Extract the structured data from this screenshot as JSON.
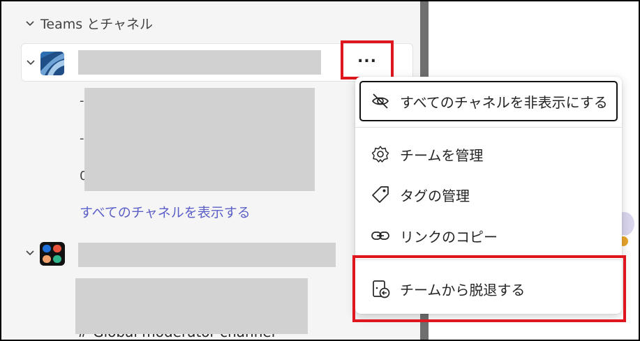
{
  "sidebar": {
    "section_title": "Teams とチャネル",
    "show_all_channels": "すべてのチャネルを表示する",
    "channel_dash_1": "-",
    "channel_dash_2": "-",
    "channel_prefix_3": "0",
    "partial_channel_text": "# Global moderator channel"
  },
  "team_more_button": "...",
  "context_menu": {
    "items": [
      {
        "label": "すべてのチャネルを非表示にする",
        "icon": "eye-off-icon"
      },
      {
        "label": "チームを管理",
        "icon": "gear-icon"
      },
      {
        "label": "タグの管理",
        "icon": "tag-icon"
      },
      {
        "label": "リンクのコピー",
        "icon": "link-icon"
      },
      {
        "label": "チームから脱退する",
        "icon": "leave-team-icon"
      }
    ]
  },
  "colors": {
    "highlight": "#e0161e",
    "link": "#5b5fc7",
    "redaction": "#d1d1d1"
  }
}
